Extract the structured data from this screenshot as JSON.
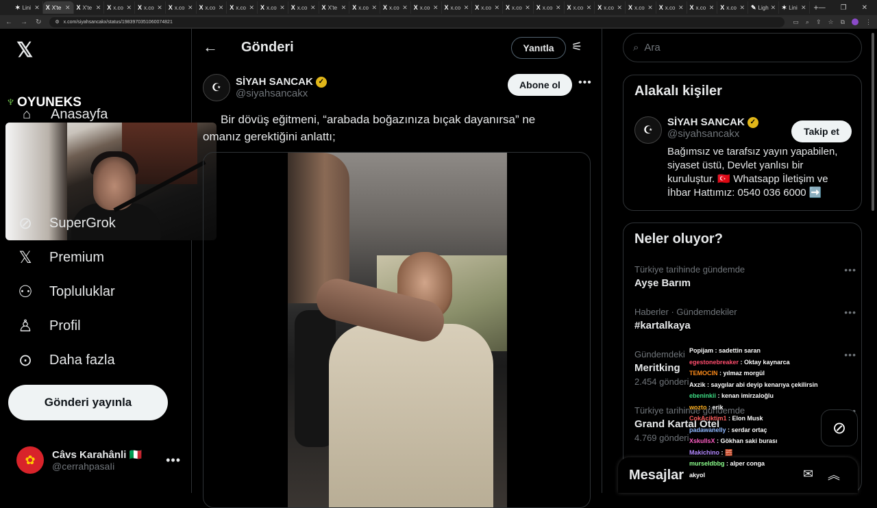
{
  "browser": {
    "tabs": [
      {
        "icon": "✶",
        "label": "Lini"
      },
      {
        "icon": "X",
        "label": "X'te",
        "active": true
      },
      {
        "icon": "X",
        "label": "X'te"
      },
      {
        "icon": "X",
        "label": "x.co"
      },
      {
        "icon": "X",
        "label": "x.co"
      },
      {
        "icon": "X",
        "label": "x.co"
      },
      {
        "icon": "X",
        "label": "x.co"
      },
      {
        "icon": "X",
        "label": "x.co"
      },
      {
        "icon": "X",
        "label": "x.co"
      },
      {
        "icon": "X",
        "label": "x.co"
      },
      {
        "icon": "X",
        "label": "X'te"
      },
      {
        "icon": "X",
        "label": "x.co"
      },
      {
        "icon": "X",
        "label": "x.co"
      },
      {
        "icon": "X",
        "label": "x.co"
      },
      {
        "icon": "X",
        "label": "x.co"
      },
      {
        "icon": "X",
        "label": "x.co"
      },
      {
        "icon": "X",
        "label": "x.co"
      },
      {
        "icon": "X",
        "label": "x.co"
      },
      {
        "icon": "X",
        "label": "x.co"
      },
      {
        "icon": "X",
        "label": "x.co"
      },
      {
        "icon": "X",
        "label": "x.co"
      },
      {
        "icon": "X",
        "label": "x.co"
      },
      {
        "icon": "X",
        "label": "x.co"
      },
      {
        "icon": "X",
        "label": "x.co"
      },
      {
        "icon": "✎",
        "label": "Ligh"
      },
      {
        "icon": "✶",
        "label": "Lini"
      }
    ],
    "url": "x.com/siyahsancakx/status/1983970351060074821"
  },
  "brand": {
    "label": "OYUNEKS"
  },
  "sidebar": {
    "home": "Anasayfa",
    "items": [
      {
        "icon": "grok-icon",
        "glyph": "⊘",
        "label": "SuperGrok"
      },
      {
        "icon": "x-premium-icon",
        "glyph": "𝕏",
        "label": "Premium"
      },
      {
        "icon": "communities-icon",
        "glyph": "⚇",
        "label": "Topluluklar"
      },
      {
        "icon": "profile-icon",
        "glyph": "♙",
        "label": "Profil"
      },
      {
        "icon": "more-circle-icon",
        "glyph": "⊙",
        "label": "Daha fazla"
      }
    ],
    "post_button": "Gönderi yayınla",
    "account": {
      "name": "Câvs Karahânli 🇮🇹",
      "handle": "@cerrahpasaIi"
    }
  },
  "main": {
    "title": "Gönderi",
    "reply_button": "Yanıtla",
    "author": {
      "name": "SİYAH SANCAK",
      "handle": "@siyahsancakx"
    },
    "subscribe_button": "Abone ol",
    "text_line1": "Bir dövüş eğitmeni, “arabada boğazınıza bıçak dayanırsa” ne",
    "text_line2": "omanız gerektiğini anlattı;"
  },
  "right": {
    "search_placeholder": "Ara",
    "related": {
      "title": "Alakalı kişiler",
      "name": "SİYAH SANCAK",
      "handle": "@siyahsancakx",
      "follow_button": "Takip et",
      "bio": "Bağımsız ve tarafsız yayın yapabilen, siyaset üstü, Devlet yanlısı bir kuruluştur. 🇹🇷 Whatsapp İletişim ve İhbar Hattımız: 0540 036 6000 ➡️"
    },
    "trends": {
      "title": "Neler oluyor?",
      "items": [
        {
          "context": "Türkiye tarihinde gündemde",
          "topic": "Ayşe Barım",
          "count": ""
        },
        {
          "context": "Haberler · Gündemdekiler",
          "topic": "#kartalkaya",
          "count": ""
        },
        {
          "context": "Gündemdeki",
          "topic": "Meritking",
          "count": "2.454 gönderi"
        },
        {
          "context": "Türkiye tarihinde gündemde",
          "topic": "Grand Kartal Otel",
          "count": "4.769 gönderi"
        }
      ]
    },
    "messages": "Mesajlar"
  },
  "chat": [
    {
      "user": "Popijam",
      "color": "#ffffff",
      "msg": "sadettin saran"
    },
    {
      "user": "egestonebreaker",
      "color": "#ff4d6d",
      "msg": "Oktay kaynarca"
    },
    {
      "user": "TEMOCIN",
      "color": "#ff8c1a",
      "msg": "yılmaz morgül"
    },
    {
      "user": "Axzik",
      "color": "#ffffff",
      "msg": "saygılar abi deyip kenarıya çekilirsin"
    },
    {
      "user": "ebeninkii",
      "color": "#3ddc84",
      "msg": "kenan imirzaloğlu"
    },
    {
      "user": "wozto",
      "color": "#ffb020",
      "msg": "erik"
    },
    {
      "user": "CokAciktim1",
      "color": "#ff5e5e",
      "msg": "Elon Musk"
    },
    {
      "user": "padawanelly",
      "color": "#8fb8ff",
      "msg": "serdar ortaç"
    },
    {
      "user": "XskullsX",
      "color": "#ff5ec4",
      "msg": "Gökhan saki burası"
    },
    {
      "user": "Makichino",
      "color": "#b388ff",
      "msg": "🧱"
    },
    {
      "user": "murseldbbg",
      "color": "#8cff8c",
      "msg": "alper conga"
    },
    {
      "user": "",
      "color": "#ffffff",
      "msg": "akyol"
    }
  ]
}
